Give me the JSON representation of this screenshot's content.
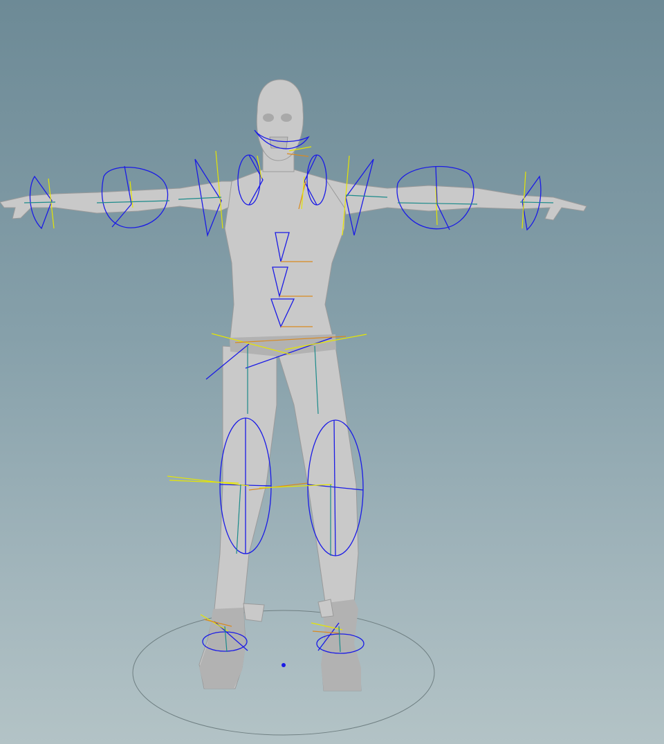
{
  "viewport": {
    "background_top": "#6d8a96",
    "background_bottom": "#b3c3c6",
    "model_color": "#c9c9c9",
    "joint_wire_color": "#1a1ae6",
    "axis_colors": [
      "#e6e600",
      "#d98a20",
      "#1a8a8a"
    ],
    "ground_circle_color": "#6f7f82"
  }
}
